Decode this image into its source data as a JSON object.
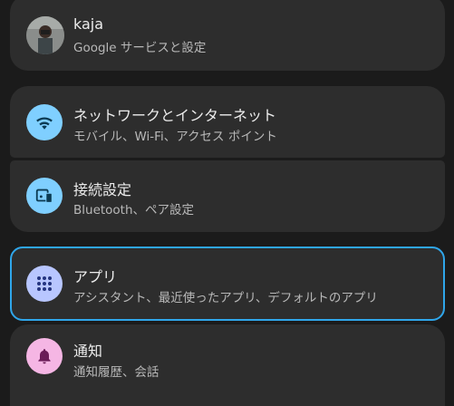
{
  "account": {
    "name": "kaja",
    "subtitle": "Google サービスと設定"
  },
  "items": [
    {
      "title": "ネットワークとインターネット",
      "subtitle": "モバイル、Wi-Fi、アクセス ポイント",
      "icon": "wifi-icon",
      "icon_bg": "#7fcfff",
      "icon_fg": "#0b3a52"
    },
    {
      "title": "接続設定",
      "subtitle": "Bluetooth、ペア設定",
      "icon": "connected-devices-icon",
      "icon_bg": "#7fcfff",
      "icon_fg": "#0b3a52"
    },
    {
      "title": "アプリ",
      "subtitle": "アシスタント、最近使ったアプリ、デフォルトのアプリ",
      "icon": "apps-grid-icon",
      "icon_bg": "#b8c6ff",
      "icon_fg": "#243480"
    },
    {
      "title": "通知",
      "subtitle": "通知履歴、会話",
      "icon": "bell-icon",
      "icon_bg": "#f5b6e4",
      "icon_fg": "#6a1b57"
    }
  ],
  "colors": {
    "background": "#1b1b1b",
    "card": "#2d2d2d",
    "focus_outline": "#2fa6ea"
  }
}
